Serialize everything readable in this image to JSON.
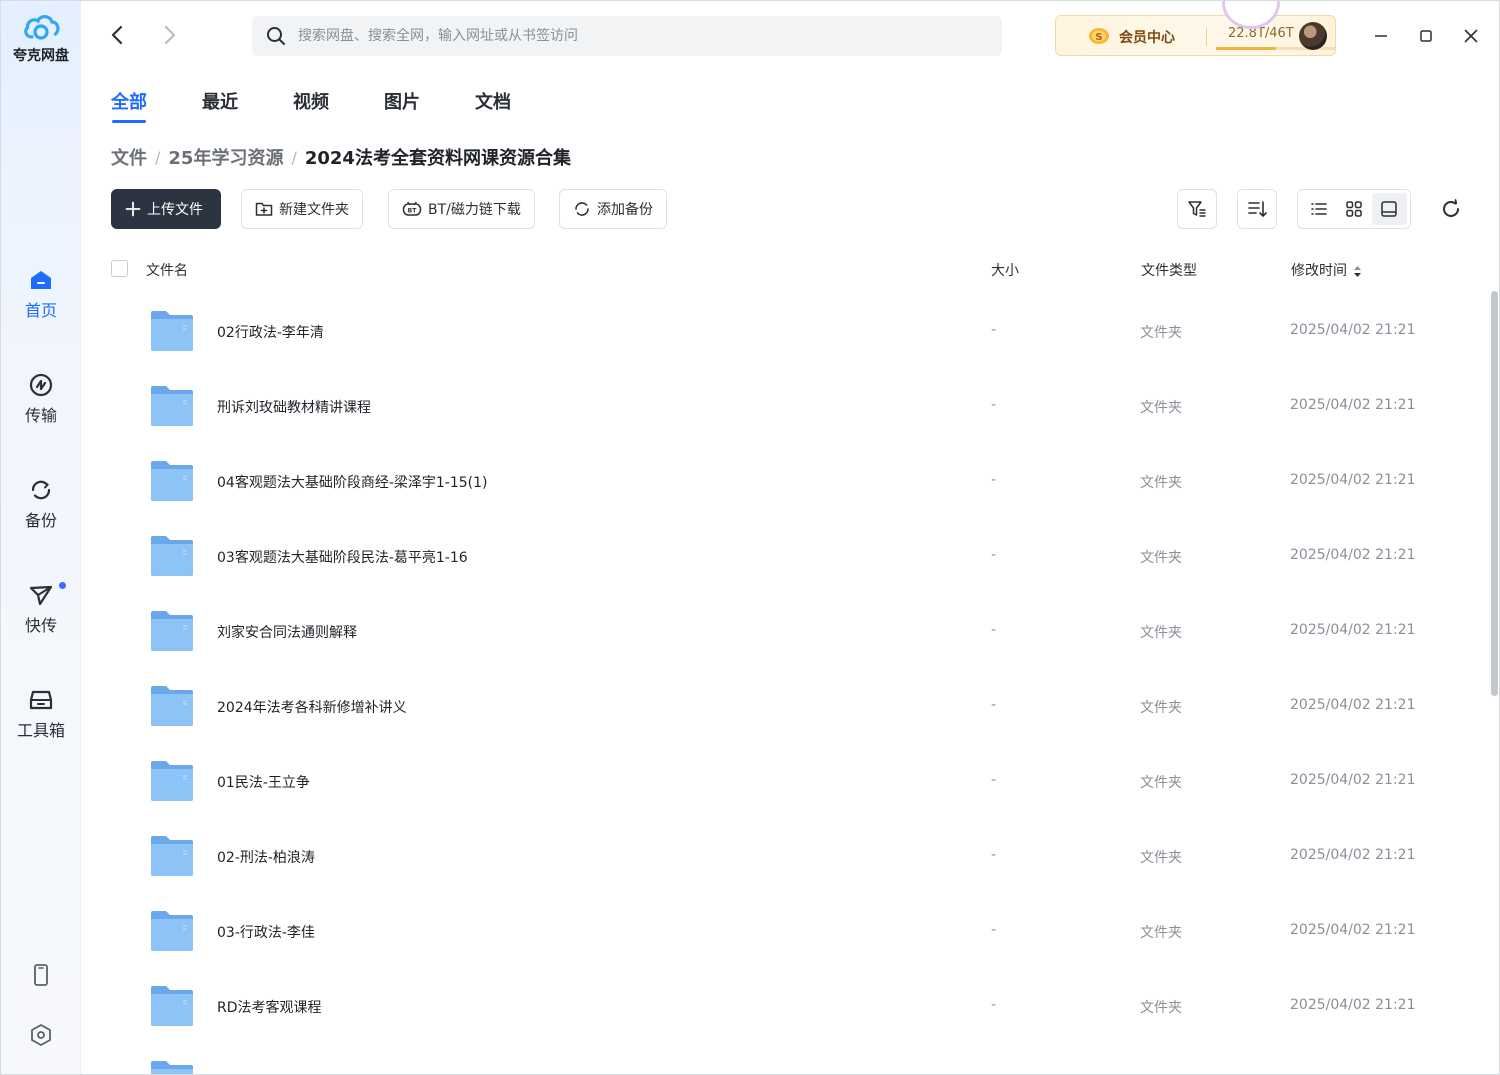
{
  "app": {
    "name": "夸克网盘"
  },
  "sidebar": {
    "items": [
      {
        "label": "首页",
        "icon": "home-icon",
        "active": true
      },
      {
        "label": "传输",
        "icon": "transfer-icon",
        "active": false
      },
      {
        "label": "备份",
        "icon": "backup-icon",
        "active": false
      },
      {
        "label": "快传",
        "icon": "fast-send-icon",
        "active": false,
        "badge_dot": true
      },
      {
        "label": "工具箱",
        "icon": "toolbox-icon",
        "active": false
      }
    ],
    "bottom": [
      {
        "icon": "phone-icon"
      },
      {
        "icon": "settings-icon"
      }
    ]
  },
  "search": {
    "placeholder": "搜索网盘、搜索全网，输入网址或从书签访问"
  },
  "vip": {
    "label": "会员中心",
    "quota": "22.8T/46T",
    "usage_fraction": 0.496
  },
  "tabs": [
    {
      "label": "全部",
      "active": true
    },
    {
      "label": "最近",
      "active": false
    },
    {
      "label": "视频",
      "active": false
    },
    {
      "label": "图片",
      "active": false
    },
    {
      "label": "文档",
      "active": false
    }
  ],
  "breadcrumb": [
    "文件",
    "25年学习资源",
    "2024法考全套资料网课资源合集"
  ],
  "toolbar": {
    "upload": "上传文件",
    "new_folder": "新建文件夹",
    "bt_download": "BT/磁力链下载",
    "add_backup": "添加备份"
  },
  "table": {
    "columns": {
      "name": "文件名",
      "size": "大小",
      "type": "文件类型",
      "modified": "修改时间"
    },
    "rows": [
      {
        "name": "02行政法-李年清",
        "size": "-",
        "type": "文件夹",
        "modified": "2025/04/02 21:21"
      },
      {
        "name": "刑诉刘玫础教材精讲课程",
        "size": "-",
        "type": "文件夹",
        "modified": "2025/04/02 21:21"
      },
      {
        "name": "04客观题法大基础阶段商经-梁泽宇1-15(1)",
        "size": "-",
        "type": "文件夹",
        "modified": "2025/04/02 21:21"
      },
      {
        "name": "03客观题法大基础阶段民法-葛平亮1-16",
        "size": "-",
        "type": "文件夹",
        "modified": "2025/04/02 21:21"
      },
      {
        "name": "刘家安合同法通则解释",
        "size": "-",
        "type": "文件夹",
        "modified": "2025/04/02 21:21"
      },
      {
        "name": "2024年法考各科新修增补讲义",
        "size": "-",
        "type": "文件夹",
        "modified": "2025/04/02 21:21"
      },
      {
        "name": "01民法-王立争",
        "size": "-",
        "type": "文件夹",
        "modified": "2025/04/02 21:21"
      },
      {
        "name": "02-刑法-柏浪涛",
        "size": "-",
        "type": "文件夹",
        "modified": "2025/04/02 21:21"
      },
      {
        "name": "03-行政法-李佳",
        "size": "-",
        "type": "文件夹",
        "modified": "2025/04/02 21:21"
      },
      {
        "name": "RD法考客观课程",
        "size": "-",
        "type": "文件夹",
        "modified": "2025/04/02 21:21"
      }
    ]
  },
  "colors": {
    "accent": "#1f6bff",
    "folder": "#7bb8f3",
    "primary_button": "#2c3341"
  }
}
